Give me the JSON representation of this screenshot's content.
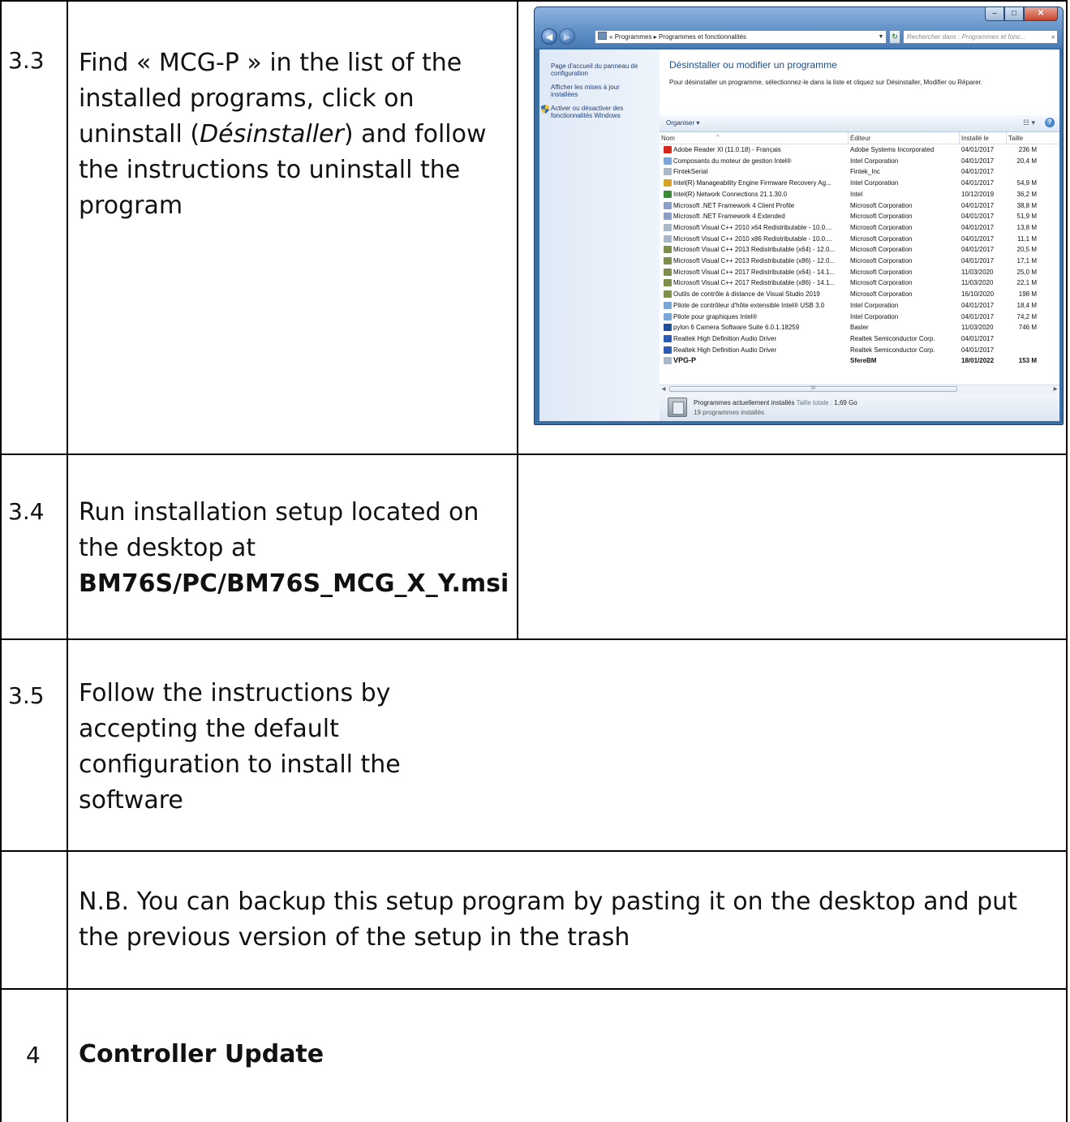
{
  "steps": [
    {
      "number": "3.3",
      "text_before": "Find « MCG-P » in the list of the installed programs, click on uninstall (",
      "text_italic": "Désinstaller",
      "text_after": ") and follow the instructions to uninstall the program"
    },
    {
      "number": "3.4",
      "text": "Run installation setup located on the desktop at",
      "path": "BM76S/PC/BM76S_MCG_X_Y.msi"
    },
    {
      "number": "3.5",
      "text": "Follow the instructions by accepting the default configuration to install the software"
    }
  ],
  "note": "N.B. You can backup this setup program by pasting it on the desktop and put the previous version of the setup in the trash",
  "section": {
    "number": "4",
    "title": "Controller Update"
  },
  "screenshot": {
    "address_prefix": "«",
    "address_parent": "Programmes",
    "address_separator": "▸",
    "address_current": "Programmes et fonctionnalités",
    "search_placeholder": "Rechercher dans : Programmes et fonc...",
    "left_links": [
      "Page d'accueil du panneau de configuration",
      "Afficher les mises à jour installées",
      "Activer ou désactiver des fonctionnalités Windows"
    ],
    "title": "Désinstaller ou modifier un programme",
    "description": "Pour désinstaller un programme, sélectionnez-le dans la liste et cliquez sur Désinstaller, Modifier ou Réparer.",
    "organize_label": "Organiser ▾",
    "columns": [
      "Nom",
      "Éditeur",
      "Installé le",
      "Taille"
    ],
    "programs": [
      {
        "name": "Adobe Reader XI (11.0.18) - Français",
        "publisher": "Adobe Systems Incorporated",
        "date": "04/01/2017",
        "size": "236 M",
        "icon": "adobe-icon",
        "color": "#d42a1e"
      },
      {
        "name": "Composants du moteur de gestion Intel®",
        "publisher": "Intel Corporation",
        "date": "04/01/2017",
        "size": "20,4 M",
        "icon": "intel-icon",
        "color": "#7aa7d8"
      },
      {
        "name": "FintekSerial",
        "publisher": "Fintek_Inc",
        "date": "04/01/2017",
        "size": "",
        "icon": "app-window-icon",
        "color": "#a9b8c9"
      },
      {
        "name": "Intel(R) Manageability Engine Firmware Recovery Ag...",
        "publisher": "Intel Corporation",
        "date": "04/01/2017",
        "size": "54,9 M",
        "icon": "shield-icon",
        "color": "#d9a326"
      },
      {
        "name": "Intel(R) Network Connections 21.1.30.0",
        "publisher": "Intel",
        "date": "10/12/2019",
        "size": "36,2 M",
        "icon": "network-icon",
        "color": "#3a8a3a"
      },
      {
        "name": "Microsoft .NET Framework 4 Client Profile",
        "publisher": "Microsoft Corporation",
        "date": "04/01/2017",
        "size": "38,8 M",
        "icon": "dotnet-icon",
        "color": "#8a9ec8"
      },
      {
        "name": "Microsoft .NET Framework 4 Extended",
        "publisher": "Microsoft Corporation",
        "date": "04/01/2017",
        "size": "51,9 M",
        "icon": "dotnet-icon",
        "color": "#8a9ec8"
      },
      {
        "name": "Microsoft Visual C++ 2010  x64 Redistributable - 10.0....",
        "publisher": "Microsoft Corporation",
        "date": "04/01/2017",
        "size": "13,8 M",
        "icon": "app-window-icon",
        "color": "#a9b8c9"
      },
      {
        "name": "Microsoft Visual C++ 2010  x86 Redistributable - 10.0....",
        "publisher": "Microsoft Corporation",
        "date": "04/01/2017",
        "size": "11,1 M",
        "icon": "app-window-icon",
        "color": "#a9b8c9"
      },
      {
        "name": "Microsoft Visual C++ 2013 Redistributable (x64) - 12.0...",
        "publisher": "Microsoft Corporation",
        "date": "04/01/2017",
        "size": "20,5 M",
        "icon": "installer-icon",
        "color": "#7e8f4c"
      },
      {
        "name": "Microsoft Visual C++ 2013 Redistributable (x86) - 12.0...",
        "publisher": "Microsoft Corporation",
        "date": "04/01/2017",
        "size": "17,1 M",
        "icon": "installer-icon",
        "color": "#7e8f4c"
      },
      {
        "name": "Microsoft Visual C++ 2017 Redistributable (x64) - 14.1...",
        "publisher": "Microsoft Corporation",
        "date": "11/03/2020",
        "size": "25,0 M",
        "icon": "installer-icon",
        "color": "#7e8f4c"
      },
      {
        "name": "Microsoft Visual C++ 2017 Redistributable (x86) - 14.1...",
        "publisher": "Microsoft Corporation",
        "date": "11/03/2020",
        "size": "22,1 M",
        "icon": "installer-icon",
        "color": "#7e8f4c"
      },
      {
        "name": "Outils de contrôle à distance de Visual Studio 2019",
        "publisher": "Microsoft Corporation",
        "date": "16/10/2020",
        "size": "198 M",
        "icon": "installer-icon",
        "color": "#7e8f4c"
      },
      {
        "name": "Pilote de contrôleur d'hôte extensible Intel® USB 3.0",
        "publisher": "Intel Corporation",
        "date": "04/01/2017",
        "size": "18,4 M",
        "icon": "intel-icon",
        "color": "#7aa7d8"
      },
      {
        "name": "Pilote pour graphiques Intel®",
        "publisher": "Intel Corporation",
        "date": "04/01/2017",
        "size": "74,2 M",
        "icon": "intel-icon",
        "color": "#7aa7d8"
      },
      {
        "name": "pylon 6 Camera Software Suite 6.0.1.18259",
        "publisher": "Basler",
        "date": "11/03/2020",
        "size": "746 M",
        "icon": "pylon-icon",
        "color": "#1e4f9c"
      },
      {
        "name": "Realtek High Definition Audio Driver",
        "publisher": "Realtek Semiconductor Corp.",
        "date": "04/01/2017",
        "size": "",
        "icon": "realtek-icon",
        "color": "#2b5db5"
      },
      {
        "name": "Realtek High Definition Audio Driver",
        "publisher": "Realtek Semiconductor Corp.",
        "date": "04/01/2017",
        "size": "",
        "icon": "realtek-icon",
        "color": "#2b5db5"
      },
      {
        "name": "VPG-P",
        "publisher": "SfereBM",
        "date": "18/01/2022",
        "size": "153 M",
        "icon": "app-window-icon",
        "color": "#a9b8c9",
        "bold": true
      }
    ],
    "scroll_thumb_label": "III",
    "details_title": "Programmes actuellement installés",
    "details_size_label": "Taille totale :",
    "details_size_value": "1,69 Go",
    "details_count": "19 programmes installés"
  }
}
